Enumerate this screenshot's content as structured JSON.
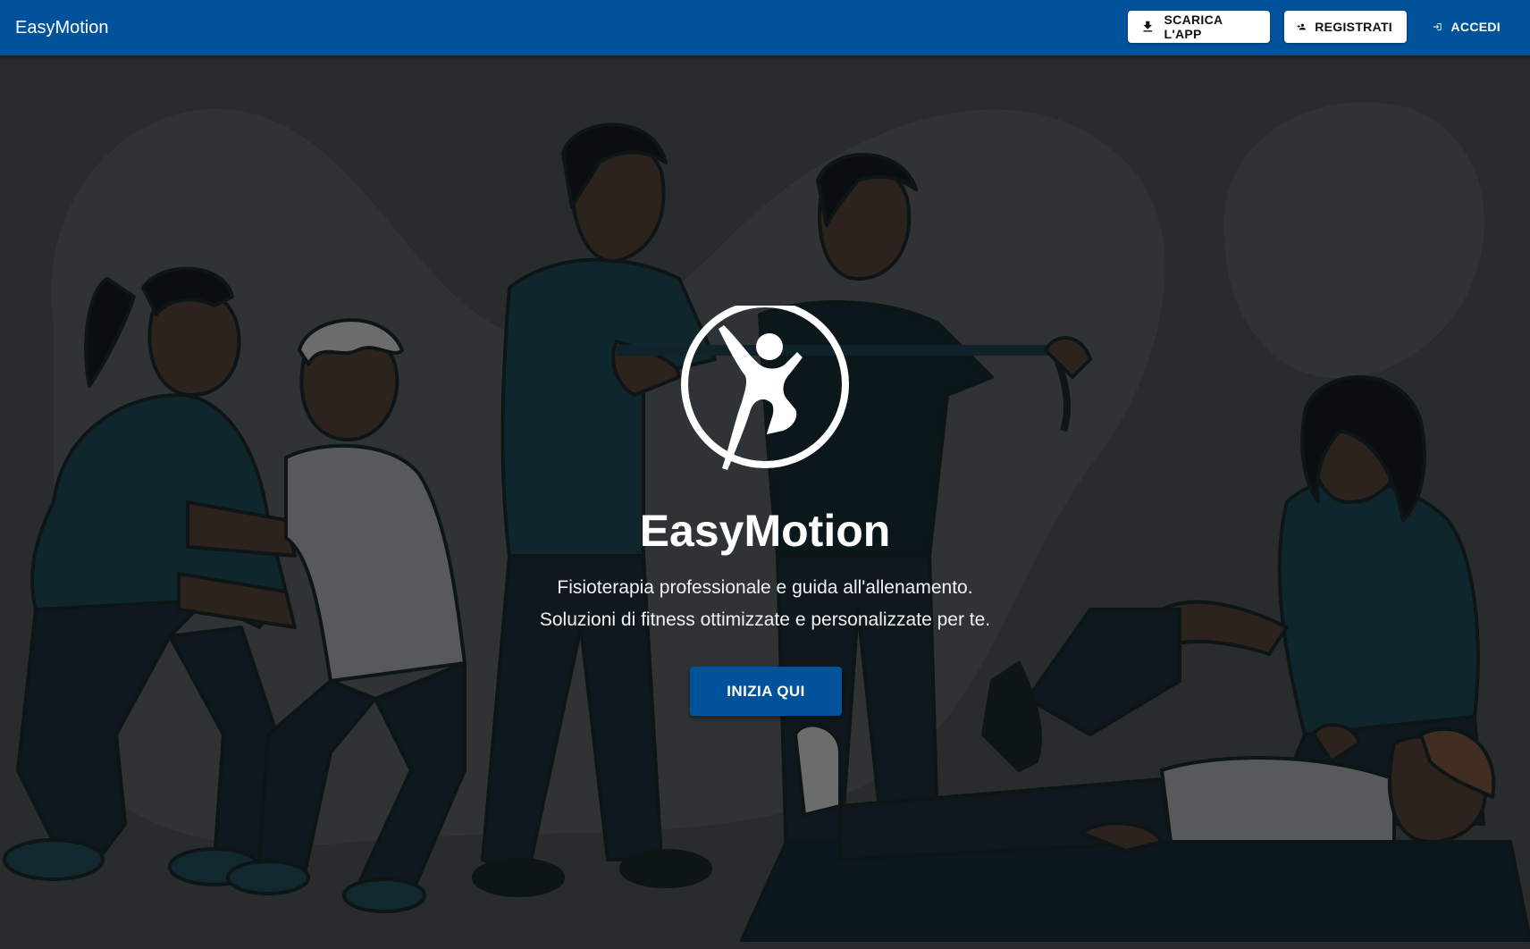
{
  "app": {
    "title": "EasyMotion"
  },
  "header": {
    "download_label": "SCARICA L'APP",
    "register_label": "REGISTRATI",
    "login_label": "ACCEDI",
    "download_icon": "download-icon",
    "register_icon": "person-add-icon",
    "login_icon": "login-icon"
  },
  "hero": {
    "title": "EasyMotion",
    "subtitle_line1": "Fisioterapia professionale e guida all'allenamento.",
    "subtitle_line2": "Soluzioni di fitness ottimizzate e personalizzate per te.",
    "cta_label": "INIZIA QUI",
    "logo_icon": "jumping-person-logo"
  },
  "colors": {
    "primary": "#00529b",
    "button_bg": "#ffffff",
    "text_light": "#ffffff"
  }
}
